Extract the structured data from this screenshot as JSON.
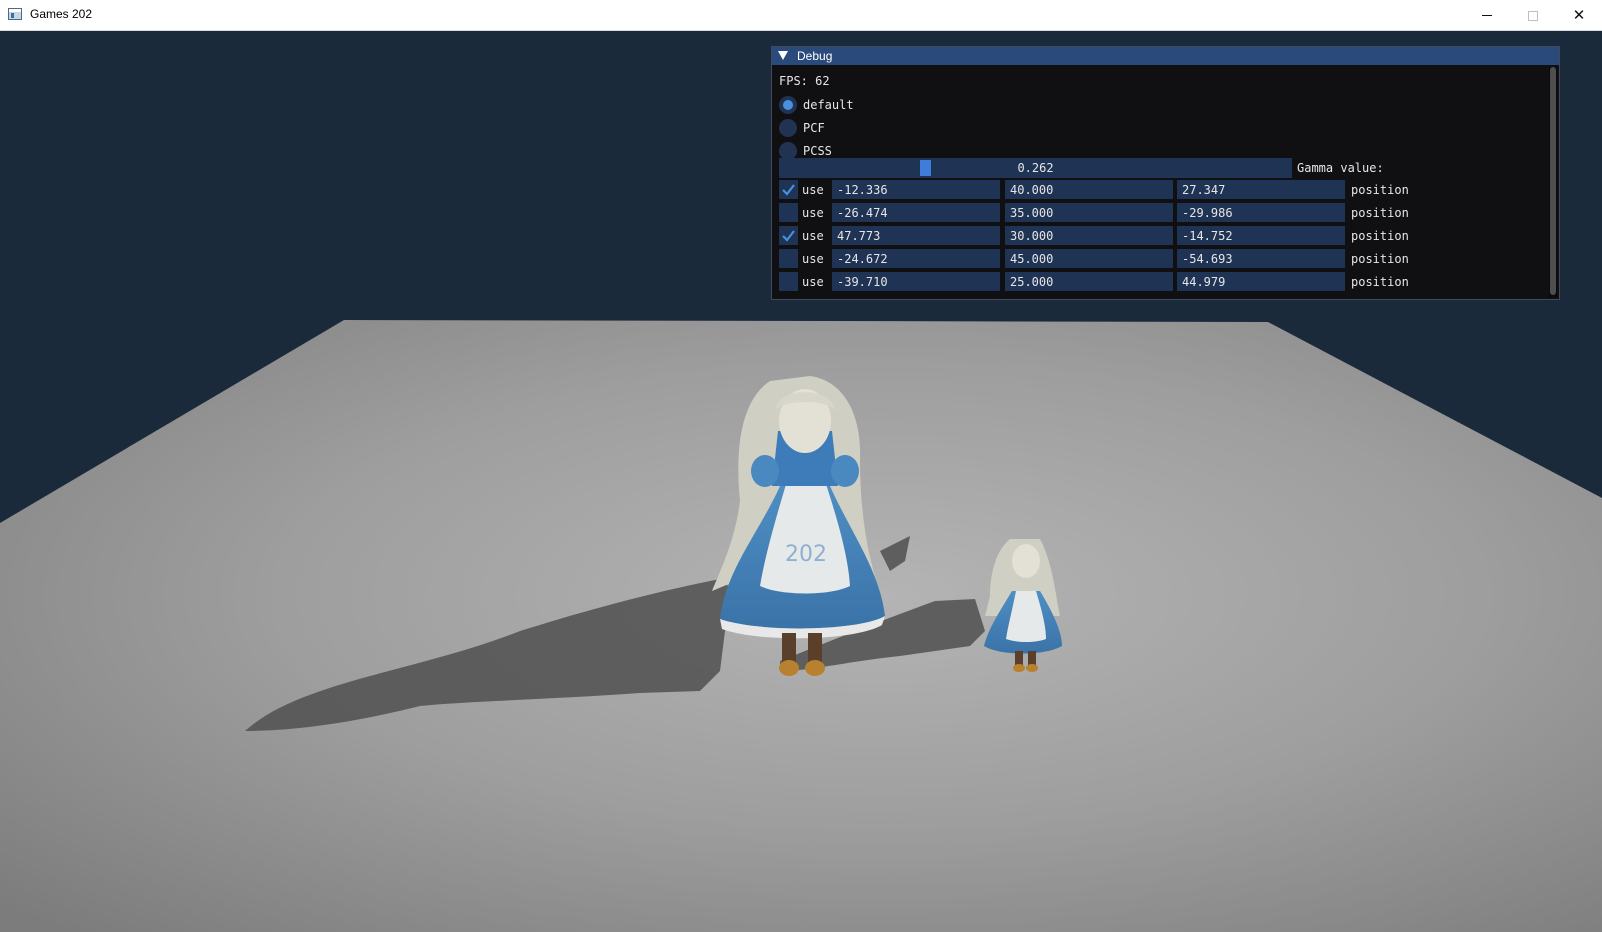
{
  "window": {
    "title": "Games 202",
    "icon": "app-window-icon",
    "controls": [
      "minimize-icon",
      "maximize-icon",
      "close-icon"
    ]
  },
  "scene": {
    "background_color": "#1b2a3a",
    "floor_color": "#9a9a9a",
    "shadow_color": "#4f4f4f",
    "apron_text": "202"
  },
  "debug": {
    "title": "Debug",
    "fps_label": "FPS: 62",
    "shadow_modes": [
      {
        "label": "default",
        "selected": true
      },
      {
        "label": "PCF",
        "selected": false
      },
      {
        "label": "PCSS",
        "selected": false
      }
    ],
    "gamma": {
      "value": "0.262",
      "label": "Gamma value:"
    },
    "lights": [
      {
        "use_label": "use",
        "checked": true,
        "x": "-12.336",
        "y": "40.000",
        "z": "27.347",
        "label": "position"
      },
      {
        "use_label": "use",
        "checked": false,
        "x": "-26.474",
        "y": "35.000",
        "z": "-29.986",
        "label": "position"
      },
      {
        "use_label": "use",
        "checked": true,
        "x": "47.773",
        "y": "30.000",
        "z": "-14.752",
        "label": "position"
      },
      {
        "use_label": "use",
        "checked": false,
        "x": "-24.672",
        "y": "45.000",
        "z": "-54.693",
        "label": "position"
      },
      {
        "use_label": "use",
        "checked": false,
        "x": "-39.710",
        "y": "25.000",
        "z": "44.979",
        "label": "position"
      }
    ],
    "accent_color": "#4a90e0"
  }
}
